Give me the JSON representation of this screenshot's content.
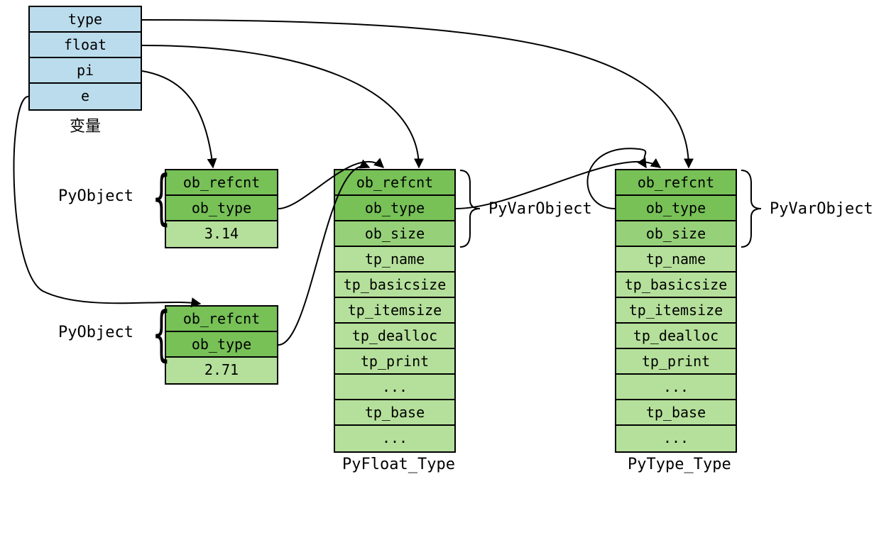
{
  "variables": {
    "cells": [
      "type",
      "float",
      "pi",
      "e"
    ],
    "caption": "变量"
  },
  "pi_obj": {
    "rows": [
      "ob_refcnt",
      "ob_type",
      "3.14"
    ],
    "brace_label": "PyObject"
  },
  "e_obj": {
    "rows": [
      "ob_refcnt",
      "ob_type",
      "2.71"
    ],
    "brace_label": "PyObject"
  },
  "float_type": {
    "rows": [
      "ob_refcnt",
      "ob_type",
      "ob_size",
      "tp_name",
      "tp_basicsize",
      "tp_itemsize",
      "tp_dealloc",
      "tp_print",
      "...",
      "tp_base",
      "..."
    ],
    "caption": "PyFloat_Type",
    "brace_label": "PyVarObject"
  },
  "type_type": {
    "rows": [
      "ob_refcnt",
      "ob_type",
      "ob_size",
      "tp_name",
      "tp_basicsize",
      "tp_itemsize",
      "tp_dealloc",
      "tp_print",
      "...",
      "tp_base",
      "..."
    ],
    "caption": "PyType_Type",
    "brace_label": "PyVarObject"
  }
}
